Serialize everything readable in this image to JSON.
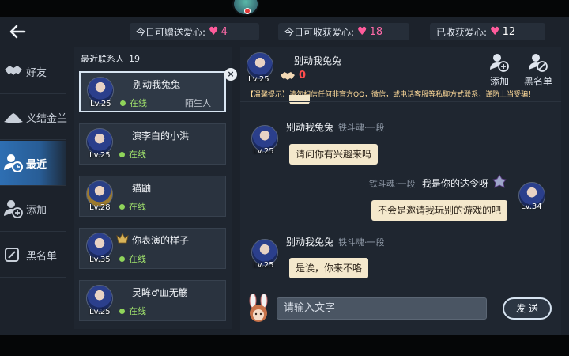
{
  "header": {
    "back_icon": "arrow-left-icon",
    "stats": [
      {
        "label": "今日可赠送爱心:",
        "value": "4"
      },
      {
        "label": "今日可收获爱心:",
        "value": "18"
      },
      {
        "label": "已收获爱心:",
        "value": "12"
      }
    ]
  },
  "sidebar": {
    "items": [
      {
        "label": "好友",
        "icon": "handshake-icon"
      },
      {
        "label": "义结金兰",
        "icon": "hat-icon"
      },
      {
        "label": "最近",
        "icon": "recent-user-icon"
      },
      {
        "label": "添加",
        "icon": "add-user-icon"
      },
      {
        "label": "黑名单",
        "icon": "blacklist-icon"
      }
    ],
    "active_index": 2
  },
  "contacts": {
    "title": "最近联系人",
    "count": "19",
    "items": [
      {
        "name": "别动我兔兔",
        "level": "Lv.25",
        "status": "在线",
        "tag": "陌生人",
        "selected": true
      },
      {
        "name": "演李白的小洪",
        "level": "Lv.25",
        "status": "在线"
      },
      {
        "name": "猫鼬",
        "level": "Lv.28",
        "status": "在线"
      },
      {
        "name": "你表演的样子",
        "level": "Lv.35",
        "status": "在线"
      },
      {
        "name": "灵眸♂血无觞",
        "level": "Lv.25",
        "status": "在线"
      }
    ],
    "close_label": "×"
  },
  "chat": {
    "partner_name": "别动我兔兔",
    "partner_level": "Lv.25",
    "affection_value": "0",
    "add_label": "添加",
    "blacklist_label": "黑名单",
    "tip": "【温馨提示】请勿相信任何非官方QQ，微信，或电话客服等私聊方式联系，谨防上当受骗！",
    "messages": [
      {
        "sender": "别动我兔兔",
        "rank": "铁斗魂·一段",
        "text": "请问你有兴趣来吗",
        "level": "Lv.25",
        "side": "left"
      },
      {
        "sender": "我是你的达令呀",
        "rank": "铁斗魂·一段",
        "text": "不会是邀请我玩别的游戏的吧",
        "level": "Lv.34",
        "side": "right"
      },
      {
        "sender": "别动我兔兔",
        "rank": "铁斗魂·一段",
        "text": "是诶，你来不咯",
        "level": "Lv.25",
        "side": "left"
      }
    ],
    "input_placeholder": "请输入文字",
    "send_label": "发 送"
  },
  "colors": {
    "accent": "#2e6fb3",
    "heart": "#ff5c9c",
    "online": "#8fd45a",
    "bubble": "#f4e8cc"
  }
}
